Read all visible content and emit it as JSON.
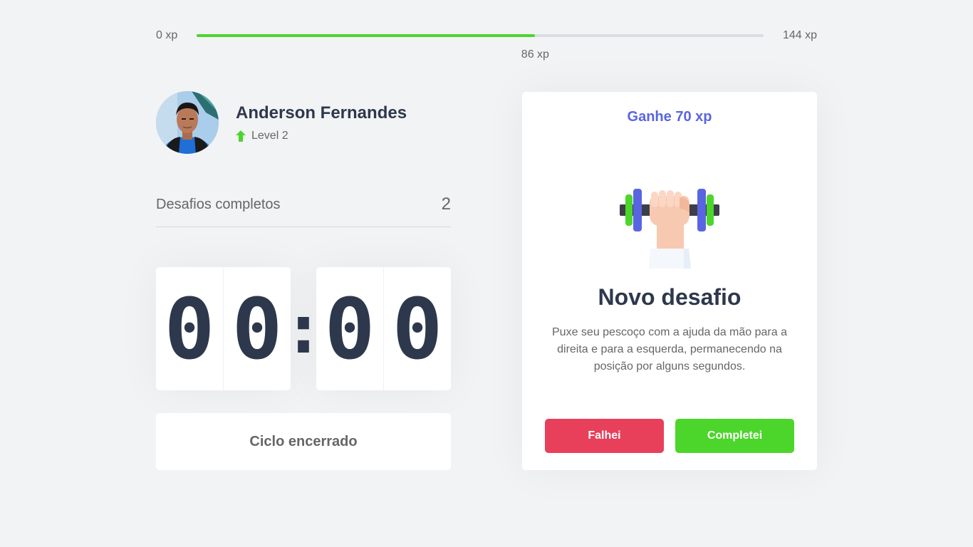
{
  "xp": {
    "min_label": "0 xp",
    "max_label": "144 xp",
    "current_label": "86 xp",
    "current": 86,
    "max": 144
  },
  "profile": {
    "name": "Anderson Fernandes",
    "level_label": "Level 2"
  },
  "completed": {
    "label": "Desafios completos",
    "count": "2"
  },
  "countdown": {
    "min_left": "0",
    "min_right": "0",
    "separator": ":",
    "sec_left": "0",
    "sec_right": "0"
  },
  "cycle_button": {
    "label": "Ciclo encerrado"
  },
  "challenge": {
    "header": "Ganhe 70 xp",
    "icon": "dumbbell-icon",
    "title": "Novo desafio",
    "description": "Puxe seu pescoço com a ajuda da mão para a direita e para a esquerda, permanecendo na posição por alguns segundos.",
    "fail_label": "Falhei",
    "success_label": "Completei"
  },
  "colors": {
    "accent": "#5965e0",
    "success": "#4cd62b",
    "fail": "#e83f5b",
    "title": "#2e384d",
    "text": "#666666",
    "background": "#f2f3f5"
  }
}
